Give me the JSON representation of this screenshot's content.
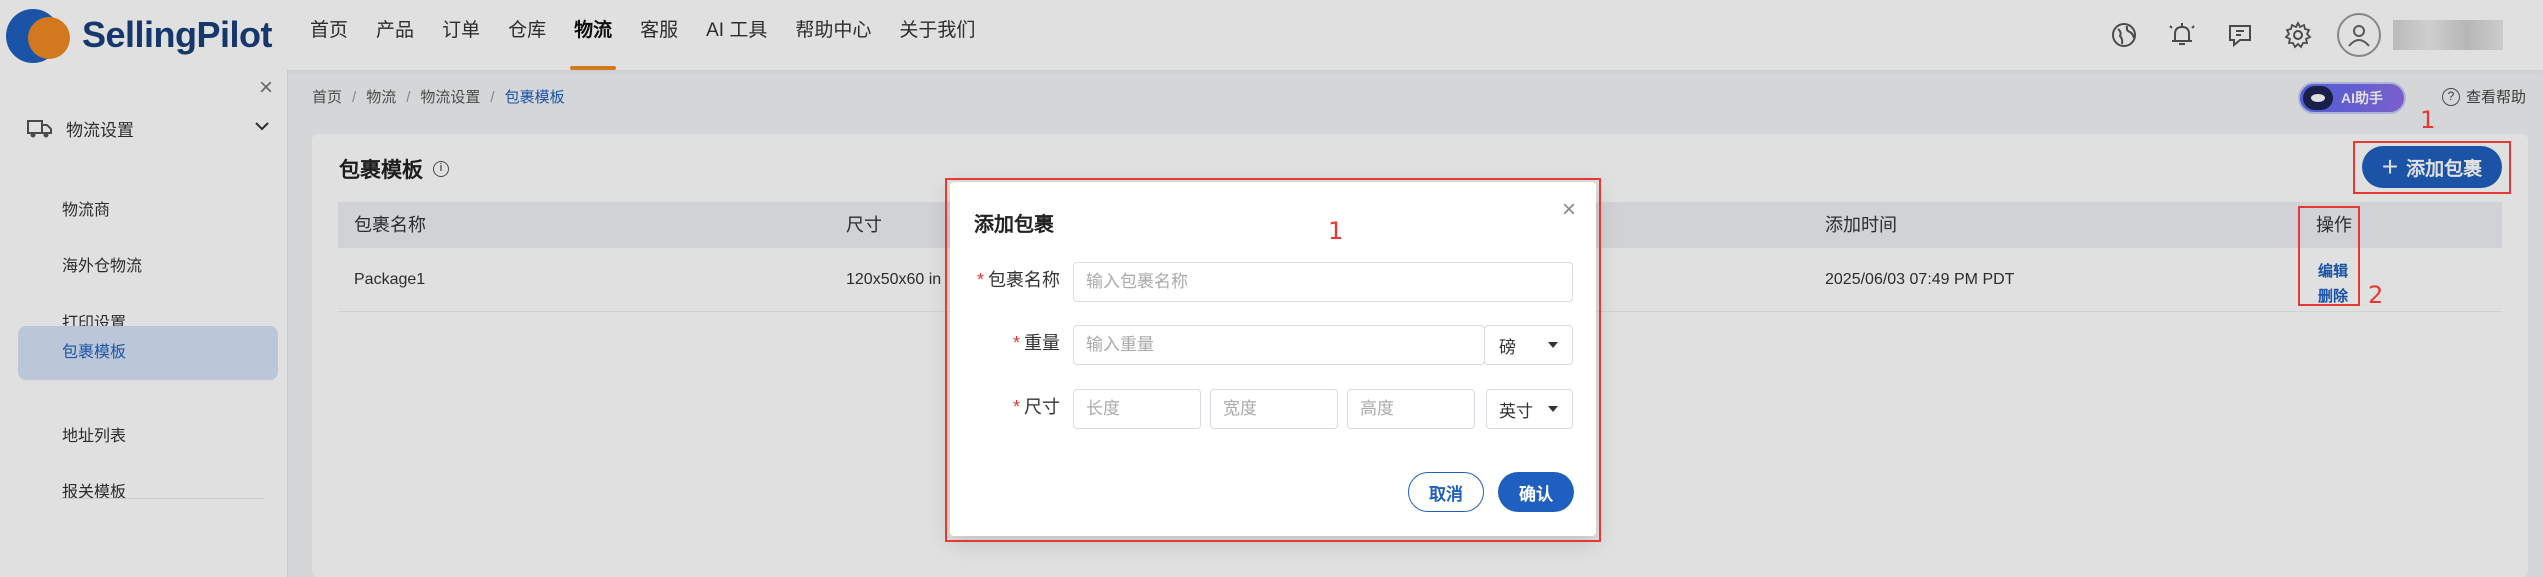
{
  "header": {
    "logo_selling": "Selling",
    "logo_pilot": "Pilot",
    "nav": [
      "首页",
      "产品",
      "订单",
      "仓库",
      "物流",
      "客服",
      "AI 工具",
      "帮助中心",
      "关于我们"
    ],
    "active_nav": "物流",
    "icons": [
      "globe-icon",
      "bell-icon",
      "message-icon",
      "gear-icon",
      "user-avatar-icon"
    ]
  },
  "sidebar": {
    "group_label": "物流设置",
    "items": [
      "物流商",
      "海外仓物流",
      "打印设置",
      "包裹模板",
      "地址列表",
      "报关模板"
    ],
    "active_item": "包裹模板"
  },
  "breadcrumb": [
    "首页",
    "物流",
    "物流设置",
    "包裹模板"
  ],
  "ai_assistant": {
    "label": "AI助手"
  },
  "help": {
    "label": "查看帮助"
  },
  "page": {
    "title": "包裹模板",
    "add_button": "添加包裹"
  },
  "table": {
    "columns": [
      "包裹名称",
      "尺寸",
      "添加时间",
      "操作"
    ],
    "rows": [
      {
        "name": "Package1",
        "size": "120x50x60 in",
        "added_time": "2025/06/03 07:49 PM PDT",
        "actions": [
          "编辑",
          "删除"
        ]
      }
    ]
  },
  "modal": {
    "title": "添加包裹",
    "name_label": "包裹名称",
    "name_placeholder": "输入包裹名称",
    "weight_label": "重量",
    "weight_placeholder": "输入重量",
    "weight_unit": "磅",
    "size_label": "尺寸",
    "length_placeholder": "长度",
    "width_placeholder": "宽度",
    "height_placeholder": "高度",
    "size_unit": "英寸",
    "cancel_label": "取消",
    "confirm_label": "确认"
  },
  "annotations": {
    "modal_marker": "1",
    "add_button_marker": "1",
    "actions_marker": "2",
    "color": "#e53935"
  }
}
